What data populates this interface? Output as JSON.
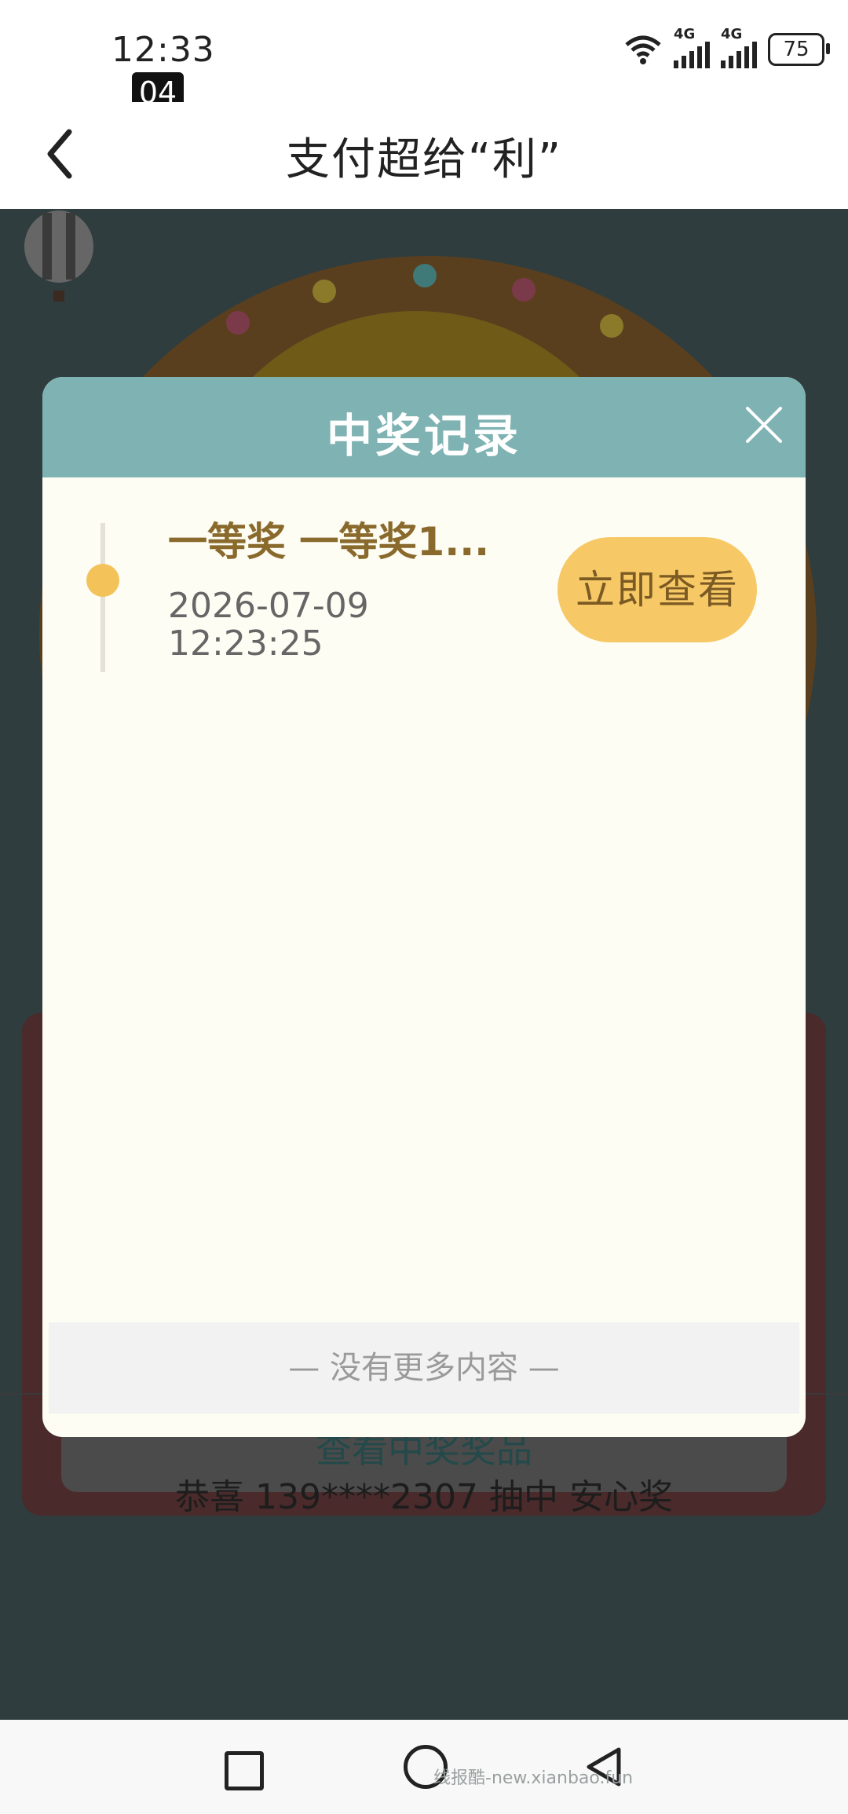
{
  "status_bar": {
    "time": "12:33",
    "badge": "04",
    "battery": "75",
    "net1": "4G",
    "net2": "4G"
  },
  "header": {
    "title": "支付超给“利”"
  },
  "background": {
    "congrats_text": "恭喜 139****2307 抽中 安心奖",
    "view_prizes_label": "查看中奖奖品"
  },
  "modal": {
    "title": "中奖记录",
    "records": [
      {
        "title": "一等奖 一等奖1...",
        "date": "2026-07-09",
        "time": "12:23:25",
        "button_label": "立即查看"
      }
    ],
    "no_more_text": "—  没有更多内容  —"
  },
  "watermark": "线报酷-new.xianbao.fun",
  "colors": {
    "modal_header": "#7fb2b2",
    "accent": "#f6c866",
    "record_title": "#8a6a2c"
  }
}
